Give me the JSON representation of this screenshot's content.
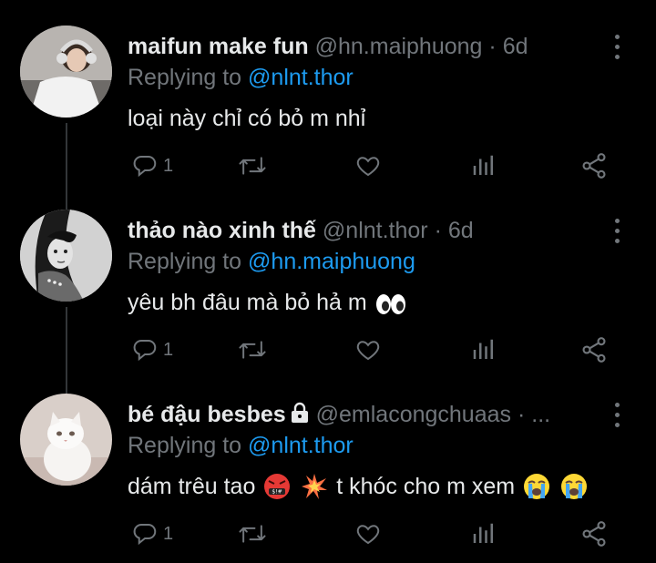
{
  "tweets": [
    {
      "name": "maifun make fun",
      "handle": "@hn.maiphuong",
      "separator": "·",
      "time": "6d",
      "replying_prefix": "Replying to",
      "replying_to": "@nlnt.thor",
      "text": "loại này chỉ có bỏ m nhỉ",
      "reply_count": "1"
    },
    {
      "name": "thảo nào xinh thế",
      "handle": "@nlnt.thor",
      "separator": "·",
      "time": "6d",
      "replying_prefix": "Replying to",
      "replying_to": "@hn.maiphuong",
      "text": "yêu bh đâu mà bỏ hả m",
      "reply_count": "1"
    },
    {
      "name": "bé đậu besbes",
      "handle": "@emlacongchuaas",
      "separator": "·",
      "time": "...",
      "replying_prefix": "Replying to",
      "replying_to": "@nlnt.thor",
      "text_part1": "dám trêu tao",
      "text_part2": "t khóc cho m xem",
      "reply_count": "1"
    }
  ],
  "colors": {
    "background": "#000000",
    "text": "#e7e9ea",
    "muted": "#71767b",
    "link": "#1d9bf0"
  },
  "icons": [
    "reply-icon",
    "retweet-icon",
    "like-icon",
    "views-icon",
    "share-icon",
    "more-icon",
    "lock-icon"
  ]
}
